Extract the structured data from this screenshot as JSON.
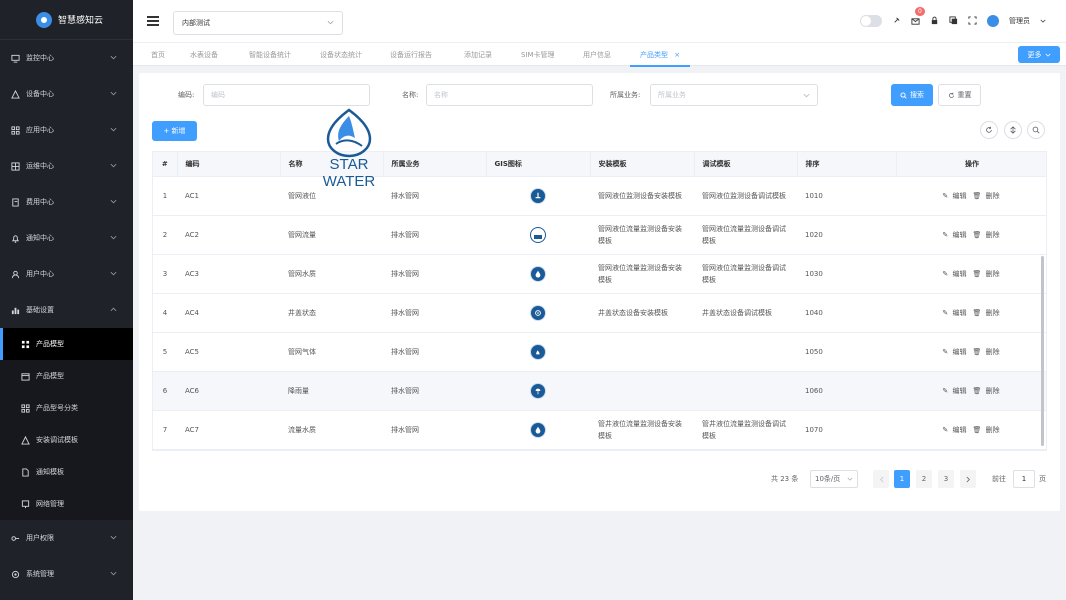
{
  "brand": {
    "title": "智慧感知云"
  },
  "sidebar": {
    "items": [
      {
        "label": "监控中心",
        "icon": "monitor-icon"
      },
      {
        "label": "设备中心",
        "icon": "device-icon"
      },
      {
        "label": "应用中心",
        "icon": "apps-icon"
      },
      {
        "label": "运维中心",
        "icon": "ops-icon"
      },
      {
        "label": "费用中心",
        "icon": "fee-icon"
      },
      {
        "label": "通知中心",
        "icon": "bell-icon"
      },
      {
        "label": "用户中心",
        "icon": "user-icon"
      },
      {
        "label": "基础设置",
        "icon": "settings-icon"
      }
    ],
    "sub_items": [
      {
        "label": "产品模型",
        "active": true
      },
      {
        "label": "产品模型",
        "active": false
      },
      {
        "label": "产品型号分类",
        "active": false
      },
      {
        "label": "安装调试模板",
        "active": false
      },
      {
        "label": "通知模板",
        "active": false
      },
      {
        "label": "网络管理",
        "active": false
      }
    ],
    "bottom_items": [
      {
        "label": "用户权限",
        "icon": "key-icon"
      },
      {
        "label": "系统管理",
        "icon": "gear-icon"
      }
    ]
  },
  "topbar": {
    "tenant_select": "内部测试",
    "notification_count": "0",
    "user_name": "管理员"
  },
  "tabs": {
    "items": [
      "首页",
      "水表设备",
      "智能设备统计",
      "设备状态统计",
      "设备运行报告",
      "添加记录",
      "SIM卡管理",
      "用户信息",
      "产品类型"
    ],
    "dropdown_label": "更多"
  },
  "filters": {
    "code_label": "编码:",
    "code_placeholder": "编码",
    "name_label": "名称:",
    "name_placeholder": "名称",
    "biz_label": "所属业务:",
    "biz_placeholder": "所属业务",
    "search_label": "搜索",
    "reset_label": "重置"
  },
  "actions": {
    "add_label": "+ 新增"
  },
  "table": {
    "columns": [
      "#",
      "编码",
      "名称",
      "所属业务",
      "GIS图标",
      "安装模板",
      "调试模板",
      "排序",
      "操作"
    ],
    "rows": [
      {
        "idx": "1",
        "code": "AC1",
        "name": "管网液位",
        "biz": "排水管网",
        "install": "管网液位监测设备安装模板",
        "debug": "管网液位监测设备调试模板",
        "sort": "1010"
      },
      {
        "idx": "2",
        "code": "AC2",
        "name": "管网流量",
        "biz": "排水管网",
        "install": "管网液位流量监测设备安装模板",
        "debug": "管网液位流量监测设备调试模板",
        "sort": "1020"
      },
      {
        "idx": "3",
        "code": "AC3",
        "name": "管网水质",
        "biz": "排水管网",
        "install": "管网液位流量监测设备安装模板",
        "debug": "管网液位流量监测设备调试模板",
        "sort": "1030"
      },
      {
        "idx": "4",
        "code": "AC4",
        "name": "井盖状态",
        "biz": "排水管网",
        "install": "井盖状态设备安装模板",
        "debug": "井盖状态设备调试模板",
        "sort": "1040"
      },
      {
        "idx": "5",
        "code": "AC5",
        "name": "管网气体",
        "biz": "排水管网",
        "install": "",
        "debug": "",
        "sort": "1050"
      },
      {
        "idx": "6",
        "code": "AC6",
        "name": "降雨量",
        "biz": "排水管网",
        "install": "",
        "debug": "",
        "sort": "1060"
      },
      {
        "idx": "7",
        "code": "AC7",
        "name": "流量水质",
        "biz": "排水管网",
        "install": "管井液位流量监测设备安装模板",
        "debug": "管井液位流量监测设备调试模板",
        "sort": "1070"
      }
    ],
    "edit_label": "编辑",
    "delete_label": "删除"
  },
  "pagination": {
    "total": "共 23 条",
    "page_size": "10条/页",
    "pages": [
      "1",
      "2",
      "3"
    ],
    "goto_label": "前往",
    "goto_value": "1",
    "page_suffix": "页"
  },
  "watermark": {
    "text": "STAR WATER"
  }
}
